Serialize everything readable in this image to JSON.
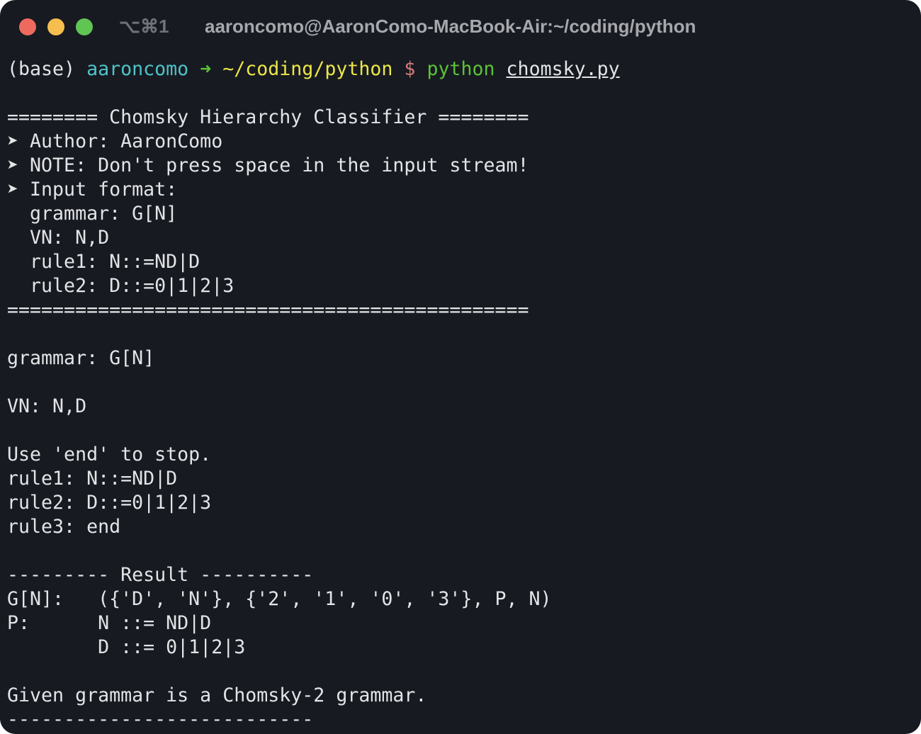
{
  "window": {
    "shortcut": "⌥⌘1",
    "title": "aaroncomo@AaronComo-MacBook-Air:~/coding/python"
  },
  "prompt": {
    "env": "(base) ",
    "user": "aaroncomo",
    "arrow": " ➜ ",
    "path": "~/coding/python",
    "dollar": " $ ",
    "cmd": "python",
    "sp": " ",
    "arg": "chomsky.py"
  },
  "lines": [
    "",
    "======== Chomsky Hierarchy Classifier ========",
    "➤ Author: AaronComo",
    "➤ NOTE: Don't press space in the input stream!",
    "➤ Input format:",
    "  grammar: G[N]",
    "  VN: N,D",
    "  rule1: N::=ND|D",
    "  rule2: D::=0|1|2|3",
    "==============================================",
    "",
    "grammar: G[N]",
    "",
    "VN: N,D",
    "",
    "Use 'end' to stop.",
    "rule1: N::=ND|D",
    "rule2: D::=0|1|2|3",
    "rule3: end",
    "",
    "--------- Result ----------",
    "G[N]:   ({'D', 'N'}, {'2', '1', '0', '3'}, P, N)",
    "P:      N ::= ND|D",
    "        D ::= 0|1|2|3",
    "",
    "Given grammar is a Chomsky-2 grammar.",
    "---------------------------"
  ]
}
